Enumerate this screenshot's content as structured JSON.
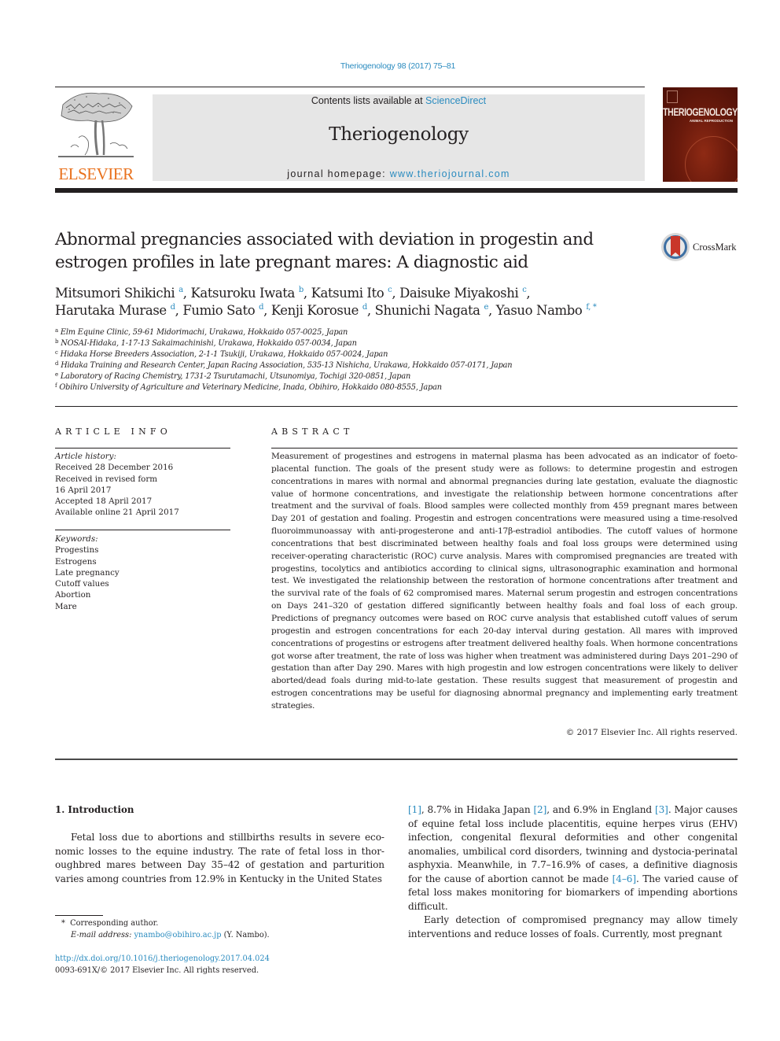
{
  "running_head": "Theriogenology 98 (2017) 75–81",
  "header": {
    "publisher_logo_text": "ELSEVIER",
    "contents_prefix": "Contents lists available at ",
    "contents_link": "ScienceDirect",
    "journal_name": "Theriogenology",
    "homepage_prefix": "journal homepage: ",
    "homepage_link": "www.theriojournal.com",
    "cover_title": "THERIOGENOLOGY",
    "cover_subtitle": "ANIMAL REPRODUCTION"
  },
  "article": {
    "title": "Abnormal pregnancies associated with deviation in progestin and estrogen profiles in late pregnant mares: A diagnostic aid",
    "crossmark_label": "CrossMark",
    "authors": [
      {
        "name": "Mitsumori Shikichi",
        "aff": "a",
        "sep": ", "
      },
      {
        "name": "Katsuroku Iwata",
        "aff": "b",
        "sep": ", "
      },
      {
        "name": "Katsumi Ito",
        "aff": "c",
        "sep": ", "
      },
      {
        "name": "Daisuke Miyakoshi",
        "aff": "c",
        "sep": ","
      },
      {
        "name": "Harutaka Murase",
        "aff": "d",
        "sep": ", "
      },
      {
        "name": "Fumio Sato",
        "aff": "d",
        "sep": ", "
      },
      {
        "name": "Kenji Korosue",
        "aff": "d",
        "sep": ", "
      },
      {
        "name": "Shunichi Nagata",
        "aff": "e",
        "sep": ", "
      },
      {
        "name": "Yasuo Nambo",
        "aff": "f, *",
        "sep": ""
      }
    ],
    "affiliations": [
      {
        "key": "a",
        "text": "Elm Equine Clinic, 59-61 Midorimachi, Urakawa, Hokkaido 057-0025, Japan"
      },
      {
        "key": "b",
        "text": "NOSAI-Hidaka, 1-17-13 Sakaimachinishi, Urakawa, Hokkaido 057-0034, Japan"
      },
      {
        "key": "c",
        "text": "Hidaka Horse Breeders Association, 2-1-1 Tsukiji, Urakawa, Hokkaido 057-0024, Japan"
      },
      {
        "key": "d",
        "text": "Hidaka Training and Research Center, Japan Racing Association, 535-13 Nishicha, Urakawa, Hokkaido 057-0171, Japan"
      },
      {
        "key": "e",
        "text": "Laboratory of Racing Chemistry, 1731-2 Tsurutamachi, Utsunomiya, Tochigi 320-0851, Japan"
      },
      {
        "key": "f",
        "text": "Obihiro University of Agriculture and Veterinary Medicine, Inada, Obihiro, Hokkaido 080-8555, Japan"
      }
    ]
  },
  "article_info": {
    "heading": "ARTICLE INFO",
    "history_label": "Article history:",
    "history": [
      "Received 28 December 2016",
      "Received in revised form",
      "16 April 2017",
      "Accepted 18 April 2017",
      "Available online 21 April 2017"
    ],
    "keywords_label": "Keywords:",
    "keywords": [
      "Progestins",
      "Estrogens",
      "Late pregnancy",
      "Cutoff values",
      "Abortion",
      "Mare"
    ]
  },
  "abstract": {
    "heading": "ABSTRACT",
    "text": "Measurement of progestines and estrogens in maternal plasma has been advocated as an indicator of foeto-placental function. The goals of the present study were as follows: to determine progestin and estrogen concentrations in mares with normal and abnormal pregnancies during late gestation, evaluate the diagnostic value of hormone concentrations, and investigate the relationship between hormone concentrations after treatment and the survival of foals. Blood samples were collected monthly from 459 pregnant mares between Day 201 of gestation and foaling. Progestin and estrogen concentrations were measured using a time-resolved fluoroimmunoassay with anti-progesterone and anti-17β-estradiol an­tibodies. The cutoff values of hormone concentrations that best discriminated between healthy foals and foal loss groups were determined using receiver-operating characteristic (ROC) curve analysis. Mares with compromised pregnancies are treated with progestins, tocolytics and antibiotics according to clinical signs, ultrasonographic examination and hormonal test. We investigated the relationship be­tween the restoration of hormone concentrations after treatment and the survival rate of the foals of 62 compromised mares. Maternal serum progestin and estrogen concentrations on Days 241–320 of gestation differed significantly between healthy foals and foal loss of each group. Predictions of preg­nancy outcomes were based on ROC curve analysis that established cutoff values of serum progestin and estrogen concentrations for each 20-day interval during gestation. All mares with improved concen­trations of progestins or estrogens after treatment delivered healthy foals. When hormone concentra­tions got worse after treatment, the rate of loss was higher when treatment was administered during Days 201–290 of gestation than after Day 290. Mares with high progestin and low estrogen concen­trations were likely to deliver aborted/dead foals during mid-to-late gestation. These results suggest that measurement of progestin and estrogen concentrations may be useful for diagnosing abnormal preg­nancy and implementing early treatment strategies.",
    "copyright": "© 2017 Elsevier Inc. All rights reserved."
  },
  "body": {
    "section_heading": "1.  Introduction",
    "col1_paragraph": "Fetal loss due to abortions and stillbirths results in severe eco­nomic losses to the equine industry. The rate of fetal loss in thor­oughbred mares between Day 35–42 of gestation and parturition varies among countries from 12.9% in Kentucky in the United States",
    "col2_segments": [
      {
        "text": "[1]",
        "link": true
      },
      {
        "text": ", 8.7% in Hidaka Japan ",
        "link": false
      },
      {
        "text": "[2]",
        "link": true
      },
      {
        "text": ", and 6.9% in England ",
        "link": false
      },
      {
        "text": "[3]",
        "link": true
      },
      {
        "text": ". Major causes of equine fetal loss include placentitis, equine herpes virus (EHV) infection, congenital flexural deformities and other congenital anomalies, umbilical cord disorders, twinning and dystocia-perinatal asphyxia. Meanwhile, in 7.7–16.9% of cases, a definitive diagnosis for the cause of abortion cannot be made ",
        "link": false
      },
      {
        "text": "[4–6]",
        "link": true
      },
      {
        "text": ". The varied cause of fetal loss makes monitoring for biomarkers of impending abortions difficult.",
        "link": false
      }
    ],
    "col2_paragraph2": "Early detection of compromised pregnancy may allow timely interventions and reduce losses of foals. Currently, most pregnant"
  },
  "footnote": {
    "marker": "*",
    "corresponding": "Corresponding author.",
    "email_label": "E-mail address:",
    "email": "ynambo@obihiro.ac.jp",
    "email_suffix": " (Y. Nambo).",
    "doi": "http://dx.doi.org/10.1016/j.theriogenology.2017.04.024",
    "issn_copyright": "0093-691X/© 2017 Elsevier Inc. All rights reserved."
  },
  "colors": {
    "link": "#2a8bbf",
    "elsevier_orange": "#e9711c",
    "text": "#231f20",
    "header_box": "#e6e6e6"
  }
}
